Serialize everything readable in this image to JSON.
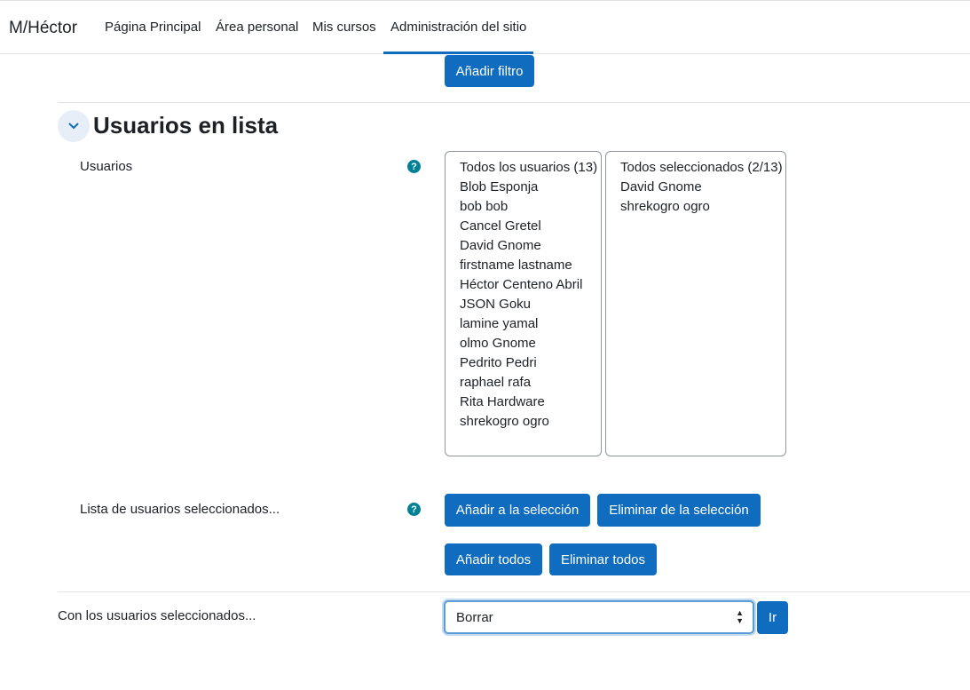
{
  "nav": {
    "brand": "M/Héctor",
    "items": [
      {
        "label": "Página Principal"
      },
      {
        "label": "Área personal"
      },
      {
        "label": "Mis cursos"
      },
      {
        "label": "Administración del sitio",
        "active": true
      }
    ]
  },
  "filter": {
    "add_filter_label": "Añadir filtro"
  },
  "section": {
    "title": "Usuarios en lista",
    "expanded": true
  },
  "users_field": {
    "label": "Usuarios",
    "available": [
      "Todos los usuarios (13)",
      "Blob Esponja",
      "bob bob",
      "Cancel Gretel",
      "David Gnome",
      "firstname lastname",
      "Héctor Centeno Abril",
      "JSON Goku",
      "lamine yamal",
      "olmo Gnome",
      "Pedrito Pedri",
      "raphael rafa",
      "Rita Hardware",
      "shrekogro ogro"
    ],
    "selected": [
      "Todos seleccionados (2/13)",
      "David Gnome",
      "shrekogro ogro"
    ]
  },
  "selection_field": {
    "label": "Lista de usuarios seleccionados...",
    "add_label": "Añadir a la selección",
    "remove_label": "Eliminar de la selección",
    "add_all_label": "Añadir todos",
    "remove_all_label": "Eliminar todos"
  },
  "bulk_action": {
    "label": "Con los usuarios seleccionados...",
    "selected_option": "Borrar",
    "go_label": "Ir"
  },
  "colors": {
    "primary": "#0f6cbf",
    "help": "#008196",
    "text": "#1d2125",
    "border": "#dee2e6"
  }
}
